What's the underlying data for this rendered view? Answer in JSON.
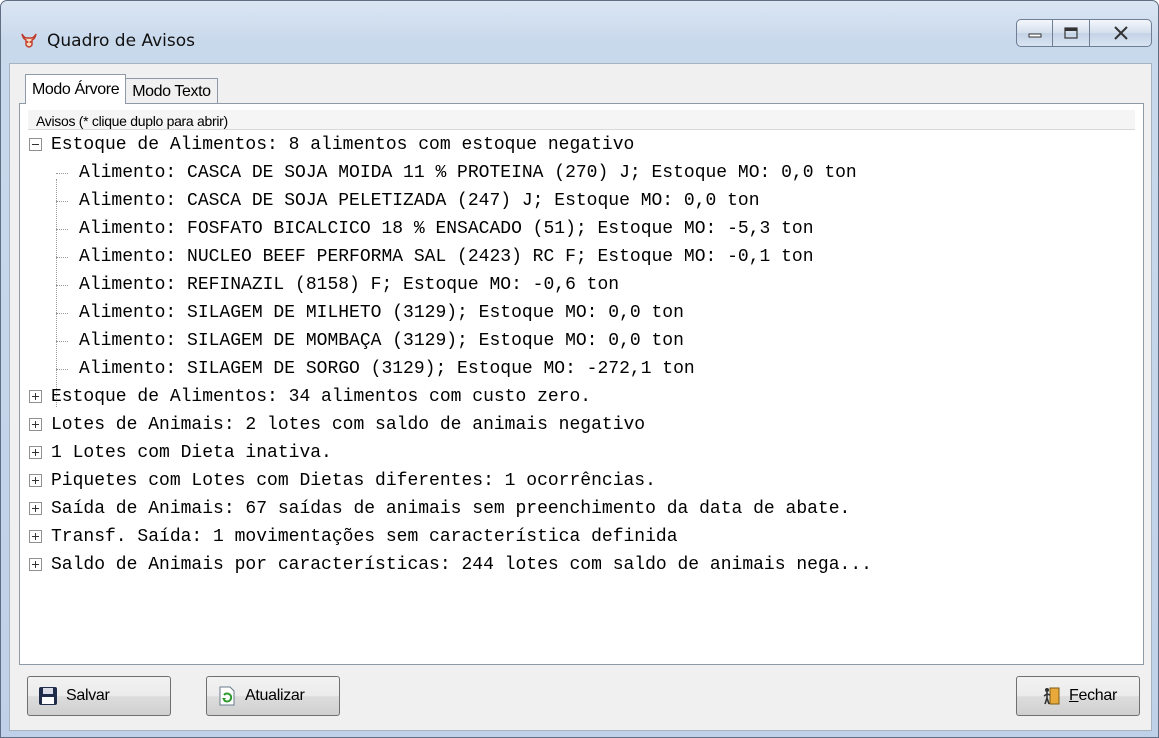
{
  "window": {
    "title": "Quadro de Avisos"
  },
  "tabs": [
    {
      "label": "Modo Árvore",
      "active": true
    },
    {
      "label": "Modo Texto",
      "active": false
    }
  ],
  "tree": {
    "header": "Avisos (* clique duplo para abrir)",
    "nodes": [
      {
        "text": "Estoque de Alimentos: 8 alimentos com estoque negativo",
        "expanded": true,
        "children": [
          "Alimento: CASCA DE SOJA MOIDA 11 % PROTEINA (270) J; Estoque MO: 0,0 ton",
          "Alimento: CASCA DE SOJA PELETIZADA (247) J; Estoque MO: 0,0 ton",
          "Alimento: FOSFATO BICALCICO 18 % ENSACADO (51); Estoque MO: -5,3 ton",
          "Alimento: NUCLEO BEEF PERFORMA SAL (2423) RC F; Estoque MO: -0,1 ton",
          "Alimento: REFINAZIL (8158) F; Estoque MO: -0,6 ton",
          "Alimento: SILAGEM DE MILHETO (3129); Estoque MO: 0,0 ton",
          "Alimento: SILAGEM DE MOMBAÇA (3129); Estoque MO: 0,0 ton",
          "Alimento: SILAGEM DE SORGO (3129); Estoque MO: -272,1 ton"
        ]
      },
      {
        "text": "Estoque de Alimentos: 34 alimentos com custo zero.",
        "expanded": false
      },
      {
        "text": "Lotes de Animais: 2 lotes com saldo de animais negativo",
        "expanded": false
      },
      {
        "text": "1 Lotes com Dieta inativa.",
        "expanded": false
      },
      {
        "text": "Piquetes com Lotes com Dietas diferentes: 1 ocorrências.",
        "expanded": false
      },
      {
        "text": "Saída de Animais: 67 saídas de animais sem preenchimento da data de abate.",
        "expanded": false
      },
      {
        "text": "Transf. Saída: 1 movimentações sem característica definida",
        "expanded": false
      },
      {
        "text": "Saldo de Animais por características: 244 lotes com saldo de animais nega...",
        "expanded": false
      }
    ]
  },
  "buttons": {
    "save": "Salvar",
    "refresh": "Atualizar",
    "close": "Fechar"
  },
  "icons": {
    "app": "cow-head-icon",
    "save": "floppy-disk-icon",
    "refresh": "refresh-document-icon",
    "close": "exit-door-icon"
  }
}
